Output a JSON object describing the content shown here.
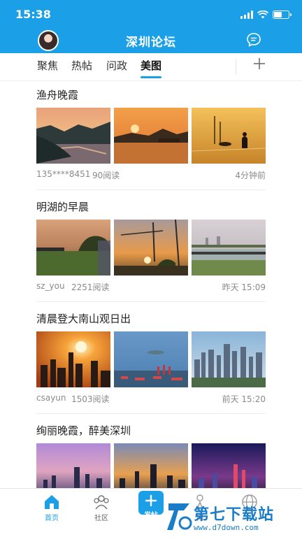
{
  "status_bar": {
    "time": "15:38"
  },
  "header": {
    "title": "深圳论坛",
    "avatar_icon": "user-avatar",
    "chat_icon": "chat-bubble-icon"
  },
  "tabs": [
    {
      "label": "聚焦",
      "active": false
    },
    {
      "label": "热帖",
      "active": false
    },
    {
      "label": "问政",
      "active": false
    },
    {
      "label": "美图",
      "active": true
    }
  ],
  "add_tab_icon": "plus-icon",
  "posts": [
    {
      "title": "渔舟晚霞",
      "author": "135****8451",
      "reads": "90阅读",
      "time": "4分钟前"
    },
    {
      "title": "明湖的早晨",
      "author": "sz_you",
      "reads": "2251阅读",
      "time": "昨天 15:09"
    },
    {
      "title": "清晨登大南山观日出",
      "author": "csayun",
      "reads": "1503阅读",
      "time": "前天 15:20"
    },
    {
      "title": "绚丽晚霞，醉美深圳",
      "author": "",
      "reads": "",
      "time": ""
    }
  ],
  "tabbar": {
    "items": [
      {
        "label": "首页",
        "icon": "home-icon",
        "active": true
      },
      {
        "label": "社区",
        "icon": "community-icon",
        "active": false
      },
      {
        "label": "发帖",
        "icon": "compose-icon",
        "active": false
      },
      {
        "label": "问",
        "icon": "question-icon",
        "active": false
      },
      {
        "label": "",
        "icon": "globe-icon",
        "active": false
      }
    ]
  },
  "watermark": {
    "text": "第七下载站",
    "url": "www.d7down.com"
  },
  "colors": {
    "accent": "#1ba0e8",
    "text": "#222222",
    "muted": "#8a8a8a"
  }
}
